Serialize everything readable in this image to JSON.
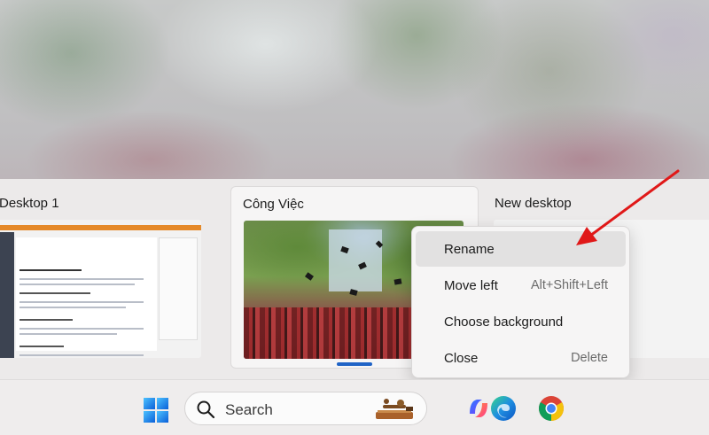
{
  "desktops": [
    {
      "label": "Desktop 1"
    },
    {
      "label": "Công Việc"
    },
    {
      "label": "New desktop"
    }
  ],
  "context_menu": {
    "items": [
      {
        "label": "Rename",
        "shortcut": ""
      },
      {
        "label": "Move left",
        "shortcut": "Alt+Shift+Left"
      },
      {
        "label": "Choose background",
        "shortcut": ""
      },
      {
        "label": "Close",
        "shortcut": "Delete"
      }
    ]
  },
  "taskbar": {
    "search_placeholder": "Search",
    "apps": [
      "windows-start-icon",
      "copilot-icon",
      "edge-icon",
      "chrome-icon"
    ]
  },
  "colors": {
    "accent": "#1f63c6",
    "annotation_arrow": "#e01818"
  }
}
